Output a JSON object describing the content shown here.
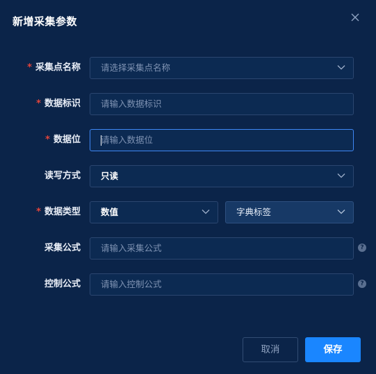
{
  "dialog": {
    "title": "新增采集参数",
    "close_icon": "close-icon"
  },
  "form": {
    "point_name": {
      "label": "采集点名称",
      "required": true,
      "placeholder": "请选择采集点名称",
      "type": "select"
    },
    "data_id": {
      "label": "数据标识",
      "required": true,
      "placeholder": "请输入数据标识",
      "type": "input"
    },
    "data_bit": {
      "label": "数据位",
      "required": true,
      "placeholder": "请输入数据位",
      "type": "input",
      "focused": true
    },
    "rw_mode": {
      "label": "读写方式",
      "required": false,
      "value": "只读",
      "type": "select"
    },
    "data_type": {
      "label": "数据类型",
      "required": true,
      "value": "数值",
      "dict_value": "字典标签",
      "type": "select"
    },
    "collect_formula": {
      "label": "采集公式",
      "required": false,
      "placeholder": "请输入采集公式",
      "type": "input",
      "help": "?"
    },
    "control_formula": {
      "label": "控制公式",
      "required": false,
      "placeholder": "请输入控制公式",
      "type": "input",
      "help": "?"
    }
  },
  "required_mark": "*",
  "buttons": {
    "cancel": "取消",
    "save": "保存"
  },
  "colors": {
    "background": "#0b2449",
    "primary": "#1a86ff",
    "required": "#e3443b",
    "focus_border": "#3f88f5"
  }
}
